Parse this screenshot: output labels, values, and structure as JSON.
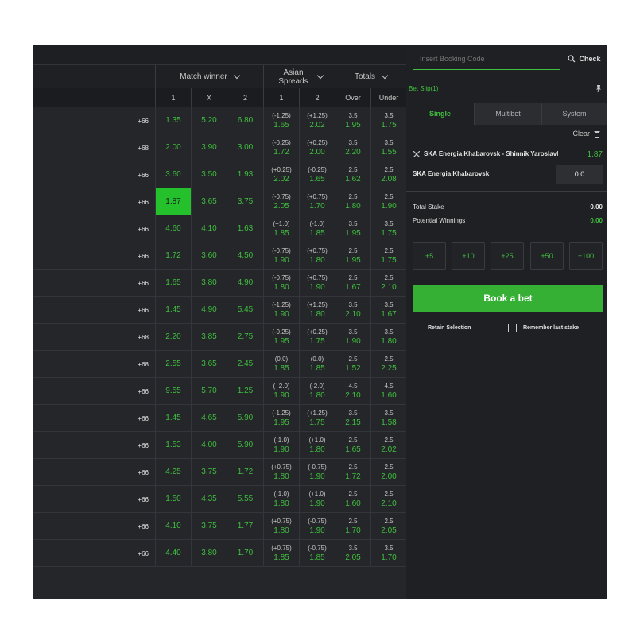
{
  "header": {
    "groups": [
      {
        "label": "Match winner"
      },
      {
        "label": "Asian Spreads"
      },
      {
        "label": "Totals"
      }
    ],
    "subcols": [
      "1",
      "X",
      "2",
      "1",
      "2",
      "Over",
      "Under"
    ]
  },
  "rows": [
    {
      "more": "+66",
      "w1": "1.35",
      "wx": "5.20",
      "w2": "6.80",
      "a1l": "(-1.25)",
      "a1o": "1.65",
      "a2l": "(+1.25)",
      "a2o": "2.02",
      "ovl": "3.5",
      "ovo": "1.95",
      "unl": "3.5",
      "uno": "1.75"
    },
    {
      "more": "+68",
      "w1": "2.00",
      "wx": "3.90",
      "w2": "3.00",
      "a1l": "(-0.25)",
      "a1o": "1.72",
      "a2l": "(+0.25)",
      "a2o": "2.00",
      "ovl": "3.5",
      "ovo": "2.20",
      "unl": "3.5",
      "uno": "1.55"
    },
    {
      "more": "+66",
      "w1": "3.60",
      "wx": "3.50",
      "w2": "1.93",
      "a1l": "(+0.25)",
      "a1o": "2.02",
      "a2l": "(-0.25)",
      "a2o": "1.65",
      "ovl": "2.5",
      "ovo": "1.62",
      "unl": "2.5",
      "uno": "2.08"
    },
    {
      "more": "+66",
      "w1": "1.87",
      "wx": "3.65",
      "w2": "3.75",
      "a1l": "(-0.75)",
      "a1o": "2.05",
      "a2l": "(+0.75)",
      "a2o": "1.70",
      "ovl": "2.5",
      "ovo": "1.80",
      "unl": "2.5",
      "uno": "1.90"
    },
    {
      "more": "+66",
      "w1": "4.60",
      "wx": "4.10",
      "w2": "1.63",
      "a1l": "(+1.0)",
      "a1o": "1.85",
      "a2l": "(-1.0)",
      "a2o": "1.85",
      "ovl": "3.5",
      "ovo": "1.95",
      "unl": "3.5",
      "uno": "1.75"
    },
    {
      "more": "+66",
      "w1": "1.72",
      "wx": "3.60",
      "w2": "4.50",
      "a1l": "(-0.75)",
      "a1o": "1.90",
      "a2l": "(+0.75)",
      "a2o": "1.80",
      "ovl": "2.5",
      "ovo": "1.95",
      "unl": "2.5",
      "uno": "1.75"
    },
    {
      "more": "+66",
      "w1": "1.65",
      "wx": "3.80",
      "w2": "4.90",
      "a1l": "(-0.75)",
      "a1o": "1.80",
      "a2l": "(+0.75)",
      "a2o": "1.90",
      "ovl": "2.5",
      "ovo": "1.67",
      "unl": "2.5",
      "uno": "2.10"
    },
    {
      "more": "+66",
      "w1": "1.45",
      "wx": "4.90",
      "w2": "5.45",
      "a1l": "(-1.25)",
      "a1o": "1.90",
      "a2l": "(+1.25)",
      "a2o": "1.80",
      "ovl": "3.5",
      "ovo": "2.10",
      "unl": "3.5",
      "uno": "1.67"
    },
    {
      "more": "+68",
      "w1": "2.20",
      "wx": "3.85",
      "w2": "2.75",
      "a1l": "(-0.25)",
      "a1o": "1.95",
      "a2l": "(+0.25)",
      "a2o": "1.75",
      "ovl": "3.5",
      "ovo": "1.90",
      "unl": "3.5",
      "uno": "1.80"
    },
    {
      "more": "+68",
      "w1": "2.55",
      "wx": "3.65",
      "w2": "2.45",
      "a1l": "(0.0)",
      "a1o": "1.85",
      "a2l": "(0.0)",
      "a2o": "1.85",
      "ovl": "2.5",
      "ovo": "1.52",
      "unl": "2.5",
      "uno": "2.25"
    },
    {
      "more": "+66",
      "w1": "9.55",
      "wx": "5.70",
      "w2": "1.25",
      "a1l": "(+2.0)",
      "a1o": "1.90",
      "a2l": "(-2.0)",
      "a2o": "1.80",
      "ovl": "4.5",
      "ovo": "2.10",
      "unl": "4.5",
      "uno": "1.60"
    },
    {
      "more": "+66",
      "w1": "1.45",
      "wx": "4.65",
      "w2": "5.90",
      "a1l": "(-1.25)",
      "a1o": "1.95",
      "a2l": "(+1.25)",
      "a2o": "1.75",
      "ovl": "3.5",
      "ovo": "2.15",
      "unl": "3.5",
      "uno": "1.58"
    },
    {
      "more": "+66",
      "w1": "1.53",
      "wx": "4.00",
      "w2": "5.90",
      "a1l": "(-1.0)",
      "a1o": "1.90",
      "a2l": "(+1.0)",
      "a2o": "1.80",
      "ovl": "2.5",
      "ovo": "1.65",
      "unl": "2.5",
      "uno": "2.02"
    },
    {
      "more": "+66",
      "w1": "4.25",
      "wx": "3.75",
      "w2": "1.72",
      "a1l": "(+0.75)",
      "a1o": "1.80",
      "a2l": "(-0.75)",
      "a2o": "1.90",
      "ovl": "2.5",
      "ovo": "1.72",
      "unl": "2.5",
      "uno": "2.00"
    },
    {
      "more": "+66",
      "w1": "1.50",
      "wx": "4.35",
      "w2": "5.55",
      "a1l": "(-1.0)",
      "a1o": "1.80",
      "a2l": "(+1.0)",
      "a2o": "1.90",
      "ovl": "2.5",
      "ovo": "1.60",
      "unl": "2.5",
      "uno": "2.10"
    },
    {
      "more": "+66",
      "w1": "4.10",
      "wx": "3.75",
      "w2": "1.77",
      "a1l": "(+0.75)",
      "a1o": "1.80",
      "a2l": "(-0.75)",
      "a2o": "1.90",
      "ovl": "2.5",
      "ovo": "1.70",
      "unl": "2.5",
      "uno": "2.05"
    },
    {
      "more": "+66",
      "w1": "4.40",
      "wx": "3.80",
      "w2": "1.70",
      "a1l": "(+0.75)",
      "a1o": "1.85",
      "a2l": "(-0.75)",
      "a2o": "1.85",
      "ovl": "3.5",
      "ovo": "2.05",
      "unl": "3.5",
      "uno": "1.70"
    }
  ],
  "selected_row": 3,
  "booking": {
    "placeholder": "Insert Booking Code",
    "check_label": "Check"
  },
  "betslip": {
    "title": "Bet Slip(1)",
    "tabs": [
      "Single",
      "Multibet",
      "System"
    ],
    "clear_label": "Clear",
    "match": "SKA Energia Khabarovsk - Shinnik Yaroslavl",
    "odd": "1.87",
    "selection": "SKA Energia Khabarovsk",
    "stake_value": "0.0",
    "total_stake_label": "Total Stake",
    "total_stake": "0.00",
    "potential_label": "Potential Winnings",
    "potential": "0.00",
    "quick_stakes": [
      "+5",
      "+10",
      "+25",
      "+50",
      "+100"
    ],
    "book_label": "Book a bet",
    "retain_label": "Retain Selection",
    "remember_label": "Remember last stake"
  },
  "colors": {
    "accent": "#3fbf3f",
    "selected_bg": "#25c12c",
    "panel": "#252629"
  }
}
